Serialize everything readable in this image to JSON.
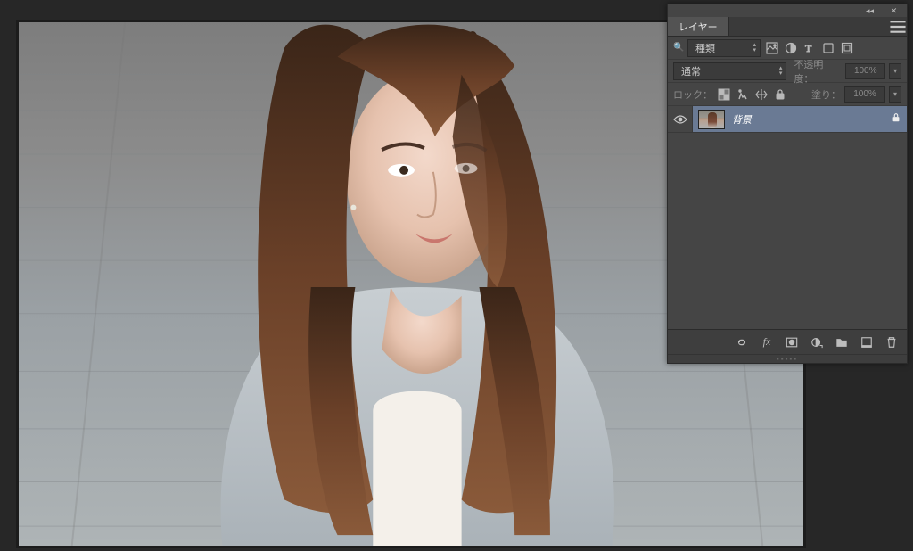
{
  "panel": {
    "title": "レイヤー",
    "filter": {
      "label": "種類"
    },
    "blend": {
      "label": "通常"
    },
    "opacity": {
      "label": "不透明度：",
      "value": "100%"
    },
    "lock": {
      "label": "ロック："
    },
    "fill": {
      "label": "塗り：",
      "value": "100%"
    }
  },
  "layers": {
    "0": {
      "name": "背景"
    }
  },
  "icons": {
    "filter_image": "image-filter-icon",
    "filter_adjust": "adjust-filter-icon",
    "filter_text": "text-filter-icon",
    "filter_shape": "shape-filter-icon",
    "filter_smart": "smart-filter-icon"
  }
}
